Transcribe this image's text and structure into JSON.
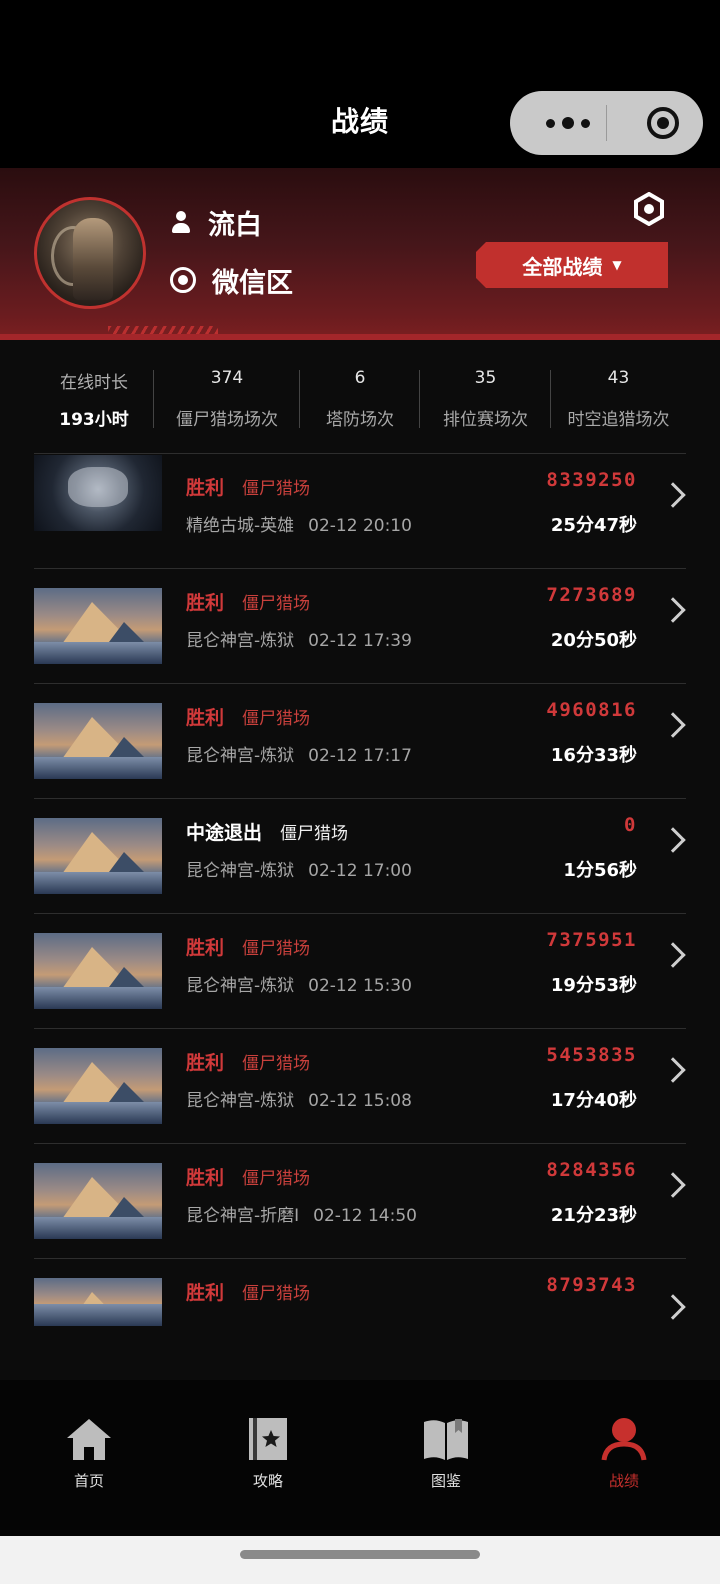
{
  "topbar": {
    "title": "战绩"
  },
  "profile": {
    "username": "流白",
    "zone": "微信区",
    "filter_button": "全部战绩",
    "filter_caret": "▼"
  },
  "stats": [
    {
      "label": "在线时长",
      "value": "193小时"
    },
    {
      "label": "僵尸猎场场次",
      "value": "374"
    },
    {
      "label": "塔防场次",
      "value": "6"
    },
    {
      "label": "排位赛场次",
      "value": "35"
    },
    {
      "label": "时空追猎场次",
      "value": "43"
    }
  ],
  "records": [
    {
      "result": "胜利",
      "mode": "僵尸猎场",
      "map": "精绝古城-英雄",
      "time": "02-12 20:10",
      "score": "8339250",
      "duration": "25分47秒"
    },
    {
      "result": "胜利",
      "mode": "僵尸猎场",
      "map": "昆仑神宫-炼狱",
      "time": "02-12 17:39",
      "score": "7273689",
      "duration": "20分50秒"
    },
    {
      "result": "胜利",
      "mode": "僵尸猎场",
      "map": "昆仑神宫-炼狱",
      "time": "02-12 17:17",
      "score": "4960816",
      "duration": "16分33秒"
    },
    {
      "result": "中途退出",
      "mode": "僵尸猎场",
      "map": "昆仑神宫-炼狱",
      "time": "02-12 17:00",
      "score": "0",
      "duration": "1分56秒"
    },
    {
      "result": "胜利",
      "mode": "僵尸猎场",
      "map": "昆仑神宫-炼狱",
      "time": "02-12 15:30",
      "score": "7375951",
      "duration": "19分53秒"
    },
    {
      "result": "胜利",
      "mode": "僵尸猎场",
      "map": "昆仑神宫-炼狱",
      "time": "02-12 15:08",
      "score": "5453835",
      "duration": "17分40秒"
    },
    {
      "result": "胜利",
      "mode": "僵尸猎场",
      "map": "昆仑神宫-折磨I",
      "time": "02-12 14:50",
      "score": "8284356",
      "duration": "21分23秒"
    },
    {
      "result": "胜利",
      "mode": "僵尸猎场",
      "map": "",
      "time": "",
      "score": "8793743",
      "duration": ""
    }
  ],
  "tabs": [
    {
      "label": "首页",
      "icon": "home-icon"
    },
    {
      "label": "攻略",
      "icon": "guide-icon"
    },
    {
      "label": "图鉴",
      "icon": "codex-icon"
    },
    {
      "label": "战绩",
      "icon": "record-icon",
      "active": true
    }
  ],
  "colors": {
    "accent": "#c7302d",
    "header_bg": "#4a1518",
    "background": "#0c0c0c"
  }
}
